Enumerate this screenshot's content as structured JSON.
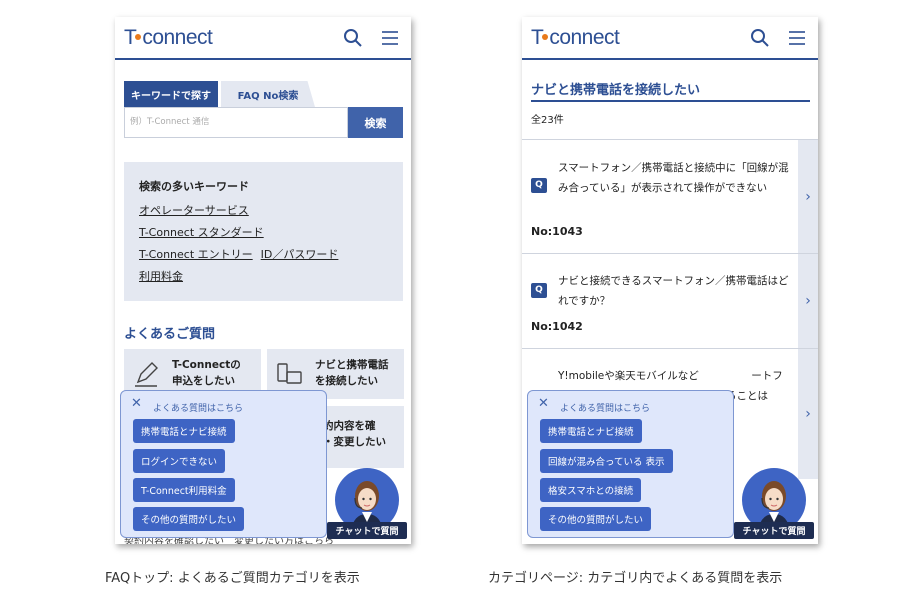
{
  "logo": {
    "text": "connect",
    "letter": "T"
  },
  "left": {
    "tabs": {
      "keyword": "キーワードで探す",
      "faq_no": "FAQ No検索"
    },
    "search": {
      "placeholder": "例）T-Connect 通信",
      "button": "検索"
    },
    "keywords": {
      "title": "検索の多いキーワード",
      "items": [
        "オペレーターサービス",
        "T-Connect スタンダード",
        "T-Connect エントリー",
        "ID／パスワード",
        "利用料金"
      ]
    },
    "section_title": "よくあるご質問",
    "categories": [
      {
        "label": "T-Connectの\n申込をしたい",
        "icon": "pen-icon"
      },
      {
        "label": "ナビと携帯電話\nを接続したい",
        "icon": "phone-navi-icon"
      },
      {
        "label": "約内容を確\n・変更したい",
        "icon": "contract-icon"
      }
    ],
    "bottom_text": "契約内容を確認したい　変更したい方はこちら"
  },
  "right": {
    "category_title": "ナビと携帯電話を接続したい",
    "count": "全23件",
    "questions": [
      {
        "badge": "Q",
        "text": "スマートフォン／携帯電話と接続中に「回線が混み合っている」が表示されて操作ができない",
        "no": "No:1043"
      },
      {
        "badge": "Q",
        "text": "ナビと接続できるスマートフォン／携帯電話はどれですか？",
        "no": "No:1042"
      },
      {
        "badge": "Q",
        "text": "Y!mobileや楽天モバイルなど　　　　　ートフォン　　　　　　　　　　　　　することは",
        "no": ""
      }
    ]
  },
  "popup_left": {
    "title": "よくある質問はこちら",
    "chips": [
      "携帯電話とナビ接続",
      "ログインできない",
      "T-Connect利用料金",
      "その他の質問がしたい"
    ]
  },
  "popup_right": {
    "title": "よくある質問はこちら",
    "chips": [
      "携帯電話とナビ接続",
      "回線が混み合っている 表示",
      "格安スマホとの接続",
      "その他の質問がしたい"
    ]
  },
  "chat_badge": "チャットで質問",
  "captions": {
    "left": "FAQトップ: よくあるご質問カテゴリを表示",
    "right": "カテゴリページ: カテゴリ内でよくある質問を表示"
  },
  "colors": {
    "brand": "#2d4f93",
    "accent": "#e97a1a",
    "chip": "#3e64c4",
    "panel": "#e4e8f1"
  }
}
